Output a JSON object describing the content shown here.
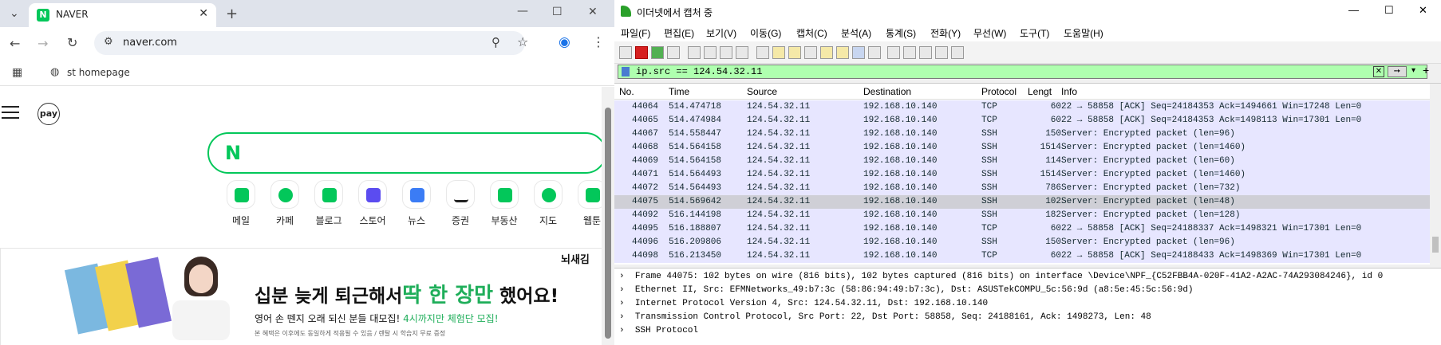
{
  "browser": {
    "tab_title": "NAVER",
    "url": "naver.com",
    "bookmark_label": "st homepage",
    "pay_label": "pay",
    "services": [
      {
        "label": "메일"
      },
      {
        "label": "카페"
      },
      {
        "label": "블로그"
      },
      {
        "label": "스토어"
      },
      {
        "label": "뉴스"
      },
      {
        "label": "증권"
      },
      {
        "label": "부동산"
      },
      {
        "label": "지도"
      },
      {
        "label": "웹툰"
      }
    ],
    "banner": {
      "brand": "뇌새김",
      "headline_plain": "십분 늦게 퇴근해서",
      "headline_accent": "딱 한 장만",
      "headline_tail": " 했어요!",
      "subline_plain": "영어 손 뗀지 오래 되신 분들 대모집!",
      "subline_accent": " 4시까지만 체험단 모집!",
      "footnote": "본 혜택은 이후에도 동일하게 적용될 수 있음 / 렌탈 시 학습지 무료 증정"
    }
  },
  "wireshark": {
    "title": "이더넷에서 캡처 중",
    "menu": [
      "파일(F)",
      "편집(E)",
      "보기(V)",
      "이동(G)",
      "캡처(C)",
      "분석(A)",
      "통계(S)",
      "전화(Y)",
      "무선(W)",
      "도구(T)",
      "도움말(H)"
    ],
    "filter": "ip.src == 124.54.32.11",
    "columns": [
      "No.",
      "Time",
      "Source",
      "Destination",
      "Protocol",
      "Lengt",
      "Info"
    ],
    "packets": [
      {
        "no": "44064",
        "time": "514.474718",
        "src": "124.54.32.11",
        "dst": "192.168.10.140",
        "proto": "TCP",
        "len": "60",
        "info": "22 → 58858 [ACK] Seq=24184353 Ack=1494661 Win=17248 Len=0"
      },
      {
        "no": "44065",
        "time": "514.474984",
        "src": "124.54.32.11",
        "dst": "192.168.10.140",
        "proto": "TCP",
        "len": "60",
        "info": "22 → 58858 [ACK] Seq=24184353 Ack=1498113 Win=17301 Len=0"
      },
      {
        "no": "44067",
        "time": "514.558447",
        "src": "124.54.32.11",
        "dst": "192.168.10.140",
        "proto": "SSH",
        "len": "150",
        "info": "Server: Encrypted packet (len=96)"
      },
      {
        "no": "44068",
        "time": "514.564158",
        "src": "124.54.32.11",
        "dst": "192.168.10.140",
        "proto": "SSH",
        "len": "1514",
        "info": "Server: Encrypted packet (len=1460)"
      },
      {
        "no": "44069",
        "time": "514.564158",
        "src": "124.54.32.11",
        "dst": "192.168.10.140",
        "proto": "SSH",
        "len": "114",
        "info": "Server: Encrypted packet (len=60)"
      },
      {
        "no": "44071",
        "time": "514.564493",
        "src": "124.54.32.11",
        "dst": "192.168.10.140",
        "proto": "SSH",
        "len": "1514",
        "info": "Server: Encrypted packet (len=1460)"
      },
      {
        "no": "44072",
        "time": "514.564493",
        "src": "124.54.32.11",
        "dst": "192.168.10.140",
        "proto": "SSH",
        "len": "786",
        "info": "Server: Encrypted packet (len=732)"
      },
      {
        "no": "44075",
        "time": "514.569642",
        "src": "124.54.32.11",
        "dst": "192.168.10.140",
        "proto": "SSH",
        "len": "102",
        "info": "Server: Encrypted packet (len=48)"
      },
      {
        "no": "44092",
        "time": "516.144198",
        "src": "124.54.32.11",
        "dst": "192.168.10.140",
        "proto": "SSH",
        "len": "182",
        "info": "Server: Encrypted packet (len=128)"
      },
      {
        "no": "44095",
        "time": "516.188807",
        "src": "124.54.32.11",
        "dst": "192.168.10.140",
        "proto": "TCP",
        "len": "60",
        "info": "22 → 58858 [ACK] Seq=24188337 Ack=1498321 Win=17301 Len=0"
      },
      {
        "no": "44096",
        "time": "516.209806",
        "src": "124.54.32.11",
        "dst": "192.168.10.140",
        "proto": "SSH",
        "len": "150",
        "info": "Server: Encrypted packet (len=96)"
      },
      {
        "no": "44098",
        "time": "516.213450",
        "src": "124.54.32.11",
        "dst": "192.168.10.140",
        "proto": "TCP",
        "len": "60",
        "info": "22 → 58858 [ACK] Seq=24188433 Ack=1498369 Win=17301 Len=0"
      }
    ],
    "selected_no": "44075",
    "details": [
      "Frame 44075: 102 bytes on wire (816 bits), 102 bytes captured (816 bits) on interface \\Device\\NPF_{C52FBB4A-020F-41A2-A2AC-74A293084246}, id 0",
      "Ethernet II, Src: EFMNetworks_49:b7:3c (58:86:94:49:b7:3c), Dst: ASUSTekCOMPU_5c:56:9d (a8:5e:45:5c:56:9d)",
      "Internet Protocol Version 4, Src: 124.54.32.11, Dst: 192.168.10.140",
      "Transmission Control Protocol, Src Port: 22, Dst Port: 58858, Seq: 24188161, Ack: 1498273, Len: 48",
      "SSH Protocol"
    ],
    "colors": {
      "row_bg": "#e7e6ff",
      "selected_bg": "#cfcfd6",
      "filter_bg": "#afffaf",
      "naver_green": "#03c75a"
    }
  }
}
